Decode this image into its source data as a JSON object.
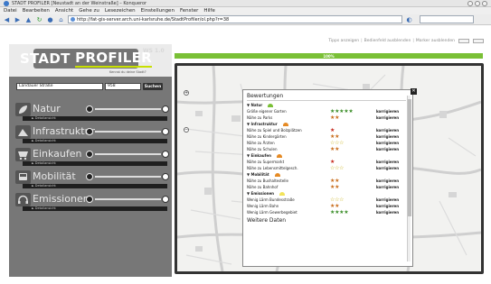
{
  "browser": {
    "title": "STADT PROFILER [Neustadt an der Weinstraße] – Konqueror",
    "menu": [
      "Datei",
      "Bearbeiten",
      "Ansicht",
      "Gehe zu",
      "Lesezeichen",
      "Einstellungen",
      "Fenster",
      "Hilfe"
    ],
    "url": "http://fat-gis-server.arch.uni-karlsruhe.de/StadtProfiler/ol.php?r=38"
  },
  "header": {
    "links": [
      "Tipps anzeigen",
      "Bedienfeld ausblenden",
      "Marker ausblenden"
    ],
    "logo_left": "STADT",
    "logo_right": "PROFILER",
    "version": "WS 1.0",
    "tagline": "Kennst du deine Stadt?"
  },
  "search": {
    "street": "Landauer Straße",
    "number": "958",
    "button": "Suchen"
  },
  "categories": [
    {
      "label": "Natur",
      "detail": "► Detailansicht"
    },
    {
      "label": "Infrastruktur",
      "detail": "► Detailansicht"
    },
    {
      "label": "Einkaufen",
      "detail": "► Detailansicht"
    },
    {
      "label": "Mobilität",
      "detail": "► Detailansicht"
    },
    {
      "label": "Emissionen",
      "detail": "► Detailansicht"
    }
  ],
  "progress": {
    "label": "100%",
    "value": 1.0
  },
  "panel": {
    "title": "Bewertungen",
    "more": "Weitere Daten",
    "groups": [
      {
        "name": "▼ Natur",
        "color": "#7ac036"
      },
      {
        "name": "▼ Infrastruktur",
        "color": "#e58a24"
      },
      {
        "name": "▼ Einkaufen",
        "color": "#e58a24"
      },
      {
        "name": "▼ Mobilität",
        "color": "#e58a24"
      },
      {
        "name": "▼ Emissionen",
        "color": "#f2e35a"
      }
    ],
    "rows": [
      {
        "label": "Größe eigener Garten",
        "stars": "★★★★★",
        "color": "#3d8f2b",
        "link": "korrigieren"
      },
      {
        "label": "Nähe zu Parks",
        "stars": "★★",
        "color": "#c96e1d",
        "link": "korrigieren"
      },
      {
        "label": "Nähe zu Spiel und Bolzplätzen",
        "stars": "★",
        "color": "#c62a1e",
        "link": "korrigieren"
      },
      {
        "label": "Nähe zu Kindergärten",
        "stars": "★★",
        "color": "#c96e1d",
        "link": "korrigieren"
      },
      {
        "label": "Nähe zu Ärzten",
        "stars": "☆☆☆",
        "color": "#c9b21d",
        "link": "korrigieren"
      },
      {
        "label": "Nähe zu Schulen",
        "stars": "★★",
        "color": "#c96e1d",
        "link": "korrigieren"
      },
      {
        "label": "Nähe zu Supermarkt",
        "stars": "★",
        "color": "#c62a1e",
        "link": "korrigieren"
      },
      {
        "label": "Nähe zu Lebensmittelgesch.",
        "stars": "☆☆☆",
        "color": "#c9b21d",
        "link": "korrigieren"
      },
      {
        "label": "Nähe zu Bushaltestelle",
        "stars": "★★",
        "color": "#c96e1d",
        "link": "korrigieren"
      },
      {
        "label": "Nähe zu Bahnhof",
        "stars": "★★",
        "color": "#c96e1d",
        "link": "korrigieren"
      },
      {
        "label": "Wenig Lärm Bundesstraße",
        "stars": "☆☆☆",
        "color": "#c9b21d",
        "link": "korrigieren"
      },
      {
        "label": "Wenig Lärm Bahn",
        "stars": "★★",
        "color": "#c96e1d",
        "link": "korrigieren"
      },
      {
        "label": "Wenig Lärm Gewerbegebiet",
        "stars": "★★★★",
        "color": "#3d8f2b",
        "link": "korrigieren"
      }
    ]
  },
  "icons": [
    "back-icon",
    "forward-icon",
    "reload-icon",
    "stop-icon",
    "home-icon",
    "globe-icon",
    "close-icon"
  ]
}
